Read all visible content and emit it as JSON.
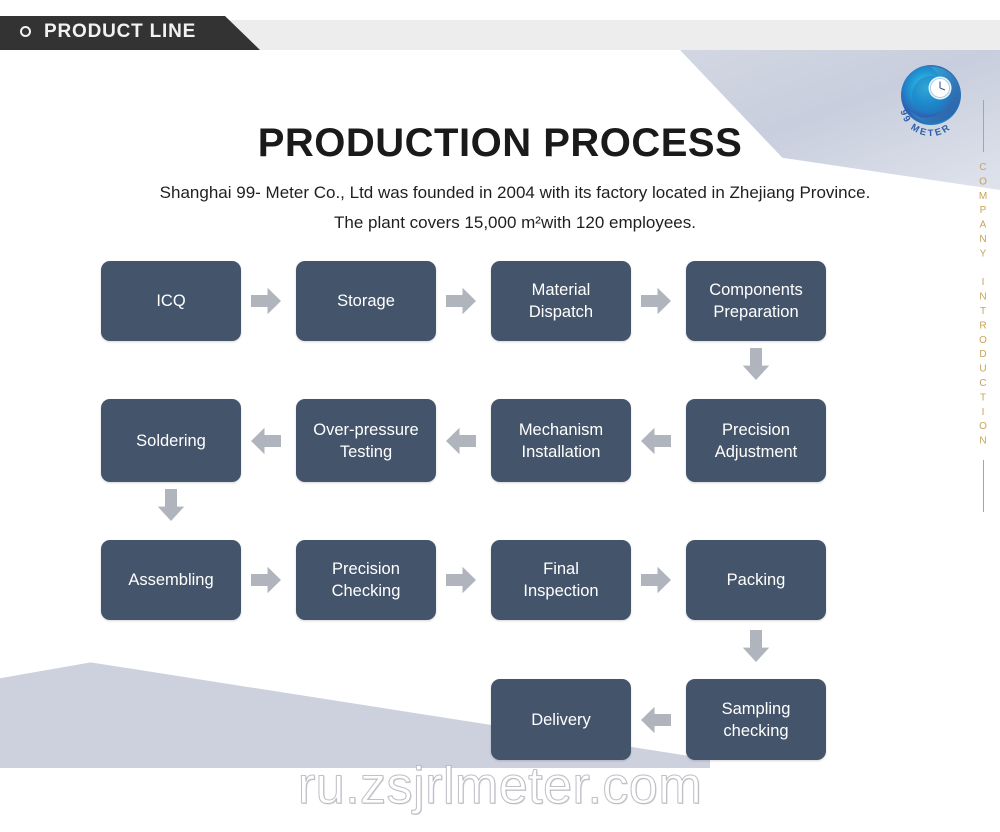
{
  "banner": {
    "label": "PRODUCT LINE",
    "bullet_icon": "circle-outline-icon"
  },
  "side_rail": {
    "text": "COMPANY INTRODUCTION",
    "color": "#c6a357"
  },
  "logo": {
    "brand": "99 METER",
    "icon": "meter-swirl-logo-icon",
    "colors": {
      "outer": "#1f9ad6",
      "mid": "#2d5fb0",
      "inner": "#3ec6e0",
      "dial": "#ffffff",
      "text": "#2b5fa8"
    }
  },
  "heading": {
    "title": "PRODUCTION PROCESS",
    "subtitle": "Shanghai 99- Meter Co., Ltd was founded in 2004 with its factory located in Zhejiang Province. The plant covers 15,000 m²with 120 employees."
  },
  "theme": {
    "node_fill": "#44546a",
    "node_text": "#ffffff",
    "arrow_fill": "#b0b4bc",
    "banner_dark": "#333333",
    "banner_strip": "#ededed",
    "deco_gray": "#ccd1dd"
  },
  "flow": {
    "nodes": [
      {
        "id": "icq",
        "label": "ICQ"
      },
      {
        "id": "storage",
        "label": "Storage"
      },
      {
        "id": "material-dispatch",
        "label": "Material\nDispatch"
      },
      {
        "id": "components-preparation",
        "label": "Components\nPreparation"
      },
      {
        "id": "precision-adjustment",
        "label": "Precision\nAdjustment"
      },
      {
        "id": "mechanism-installation",
        "label": "Mechanism\nInstallation"
      },
      {
        "id": "over-pressure-testing",
        "label": "Over-pressure\nTesting"
      },
      {
        "id": "soldering",
        "label": "Soldering"
      },
      {
        "id": "assembling",
        "label": "Assembling"
      },
      {
        "id": "precision-checking",
        "label": "Precision\nChecking"
      },
      {
        "id": "final-inspection",
        "label": "Final\nInspection"
      },
      {
        "id": "packing",
        "label": "Packing"
      },
      {
        "id": "sampling-checking",
        "label": "Sampling\nchecking"
      },
      {
        "id": "delivery",
        "label": "Delivery"
      }
    ],
    "arrows": [
      {
        "from": "icq",
        "to": "storage",
        "direction": "right"
      },
      {
        "from": "storage",
        "to": "material-dispatch",
        "direction": "right"
      },
      {
        "from": "material-dispatch",
        "to": "components-preparation",
        "direction": "right"
      },
      {
        "from": "components-preparation",
        "to": "precision-adjustment",
        "direction": "down"
      },
      {
        "from": "precision-adjustment",
        "to": "mechanism-installation",
        "direction": "left"
      },
      {
        "from": "mechanism-installation",
        "to": "over-pressure-testing",
        "direction": "left"
      },
      {
        "from": "over-pressure-testing",
        "to": "soldering",
        "direction": "left"
      },
      {
        "from": "soldering",
        "to": "assembling",
        "direction": "down"
      },
      {
        "from": "assembling",
        "to": "precision-checking",
        "direction": "right"
      },
      {
        "from": "precision-checking",
        "to": "final-inspection",
        "direction": "right"
      },
      {
        "from": "final-inspection",
        "to": "packing",
        "direction": "right"
      },
      {
        "from": "packing",
        "to": "sampling-checking",
        "direction": "down"
      },
      {
        "from": "sampling-checking",
        "to": "delivery",
        "direction": "left"
      }
    ]
  },
  "watermark": {
    "text": "ru.zsjrlmeter.com"
  }
}
